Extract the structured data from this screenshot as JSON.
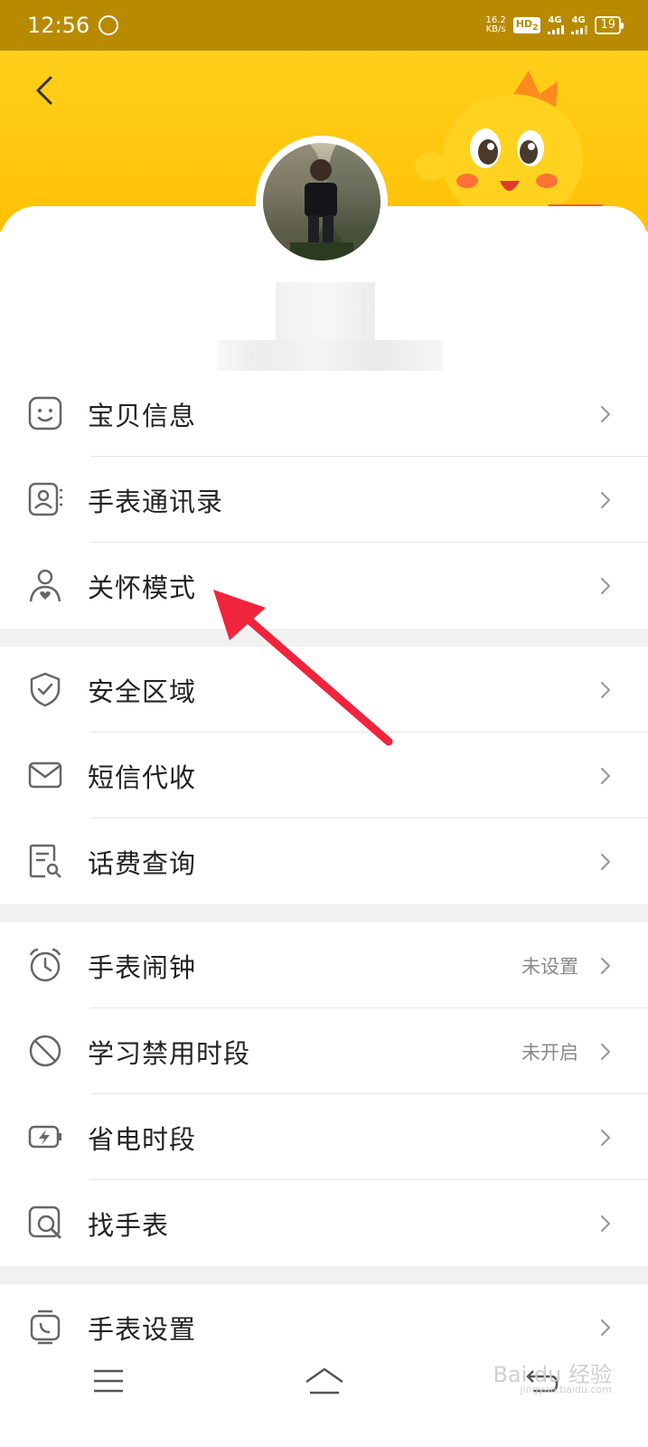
{
  "status_bar": {
    "time": "12:56",
    "net_speed_value": "16.2",
    "net_speed_unit": "KB/s",
    "hd_label": "HD",
    "hd_sub": "2",
    "signal1": "4G",
    "signal2": "4G",
    "battery": "19"
  },
  "menu": {
    "group1": [
      {
        "label": "宝贝信息",
        "icon": "smiley-icon"
      },
      {
        "label": "手表通讯录",
        "icon": "contact-card-icon"
      },
      {
        "label": "关怀模式",
        "icon": "care-person-icon"
      }
    ],
    "group2": [
      {
        "label": "安全区域",
        "icon": "shield-check-icon"
      },
      {
        "label": "短信代收",
        "icon": "envelope-icon"
      },
      {
        "label": "话费查询",
        "icon": "bill-search-icon"
      }
    ],
    "group3": [
      {
        "label": "手表闹钟",
        "value": "未设置",
        "icon": "alarm-clock-icon"
      },
      {
        "label": "学习禁用时段",
        "value": "未开启",
        "icon": "prohibited-icon"
      },
      {
        "label": "省电时段",
        "icon": "battery-saver-icon"
      },
      {
        "label": "找手表",
        "icon": "find-watch-icon"
      }
    ],
    "group4": [
      {
        "label": "手表设置",
        "icon": "watch-settings-icon"
      }
    ]
  },
  "watermark": {
    "text": "Bai du 经验",
    "sub": "jingyan.baidu.com"
  },
  "colors": {
    "header_yellow": "#ffc107",
    "status_bar": "#b88a00",
    "annotation_red": "#f0243d"
  }
}
